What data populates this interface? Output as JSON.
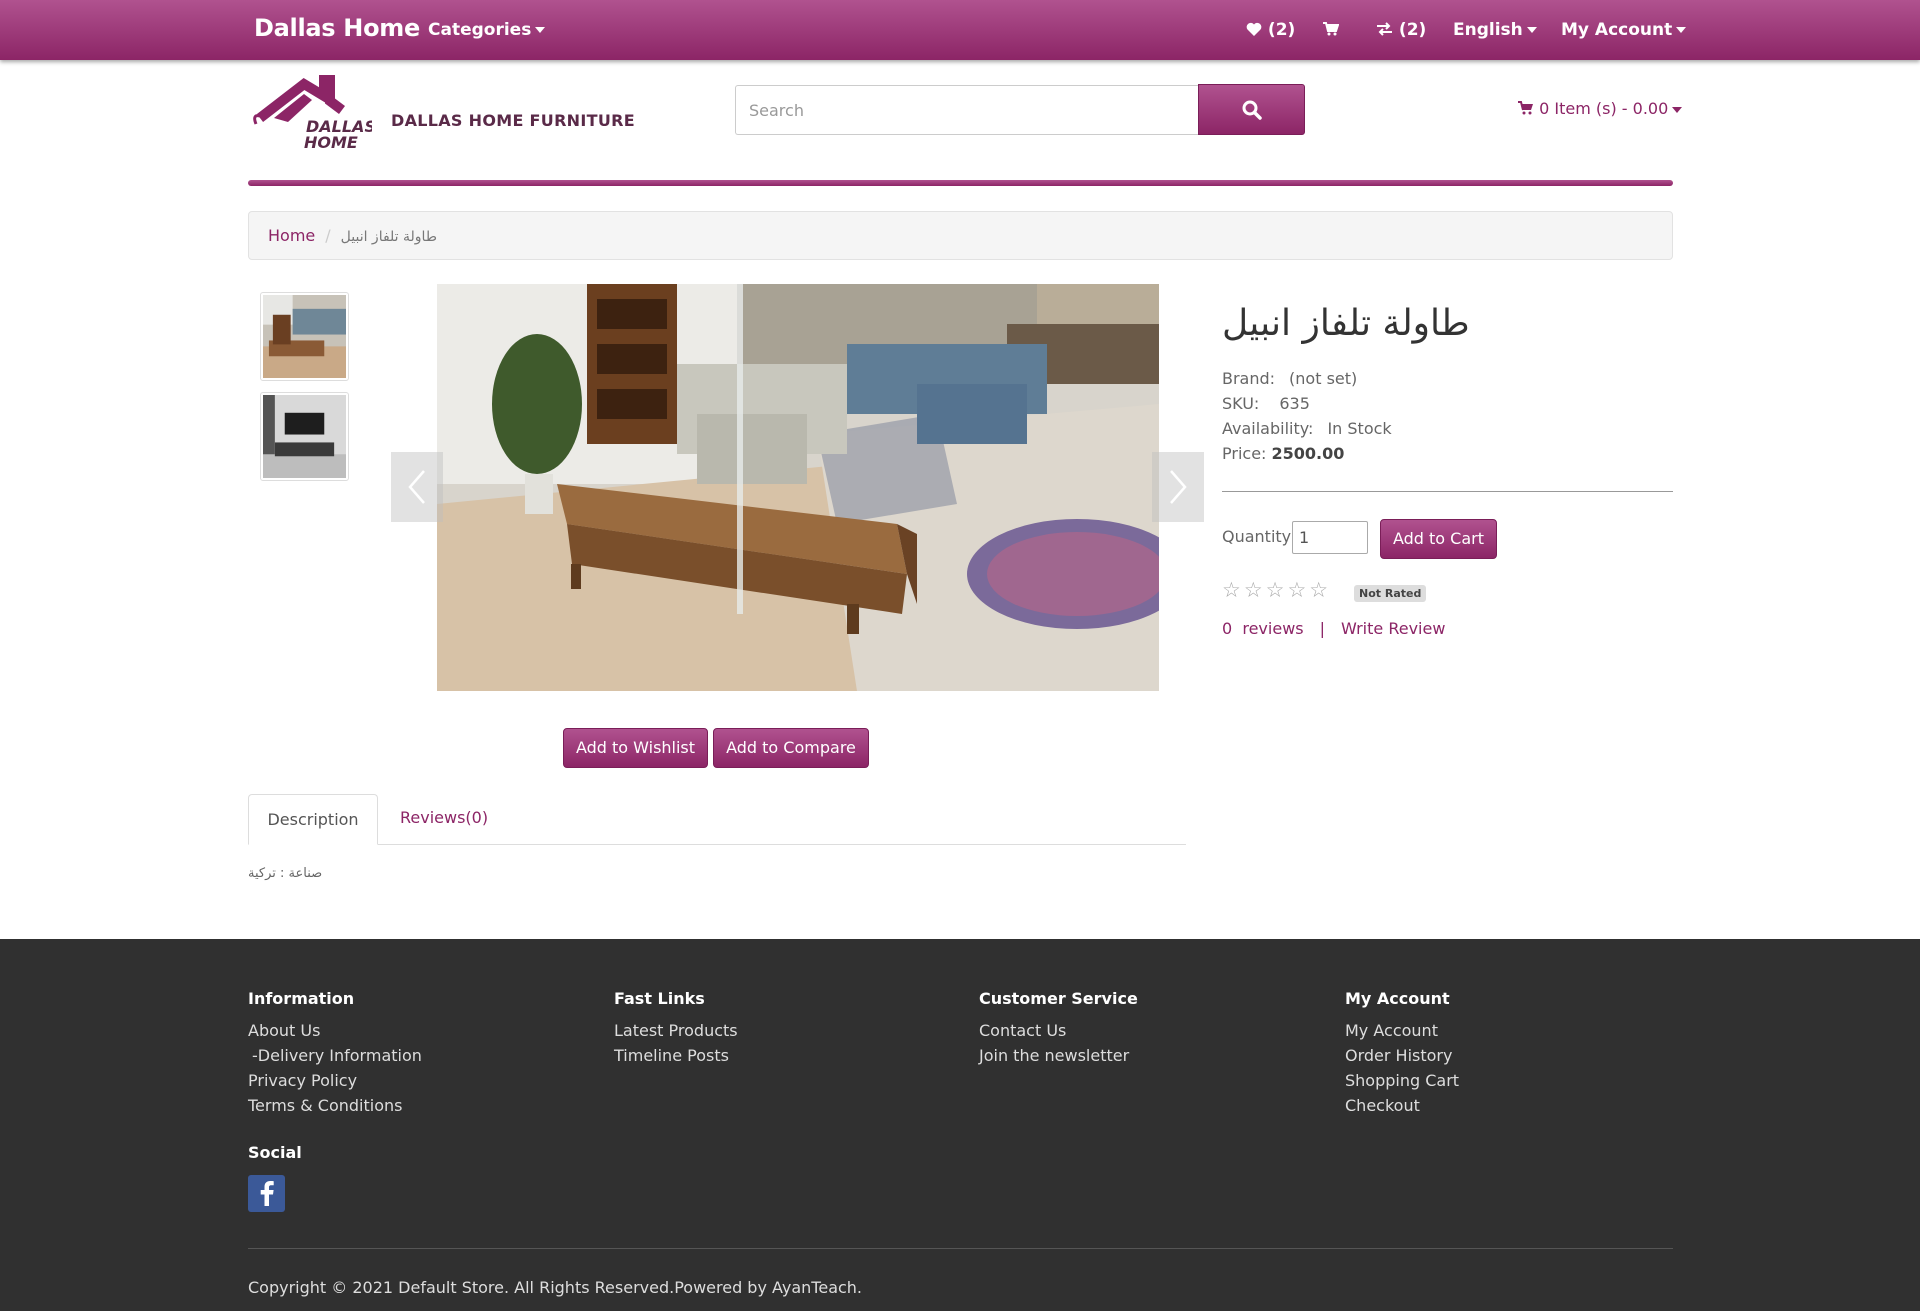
{
  "topbar": {
    "brand": "Dallas Home",
    "categories": "Categories",
    "wishlist_count": "(2)",
    "compare_count": "(2)",
    "language": "English",
    "account": "My Account"
  },
  "header": {
    "logo_text_top": "DALLAS",
    "logo_text_bottom": "HOME",
    "store_name": "DALLAS HOME FURNITURE",
    "search_placeholder": "Search",
    "cart_summary": "0 Item (s) - 0.00"
  },
  "breadcrumb": {
    "home": "Home",
    "separator": "/",
    "current": "طاولة تلفاز انبيل"
  },
  "product": {
    "title": "طاولة تلفاز انبيل",
    "brand_label": "Brand:",
    "brand_value": "(not set)",
    "sku_label": "SKU:",
    "sku_value": "635",
    "availability_label": "Availability:",
    "availability_value": "In Stock",
    "price_label": "Price:",
    "price_value": "2500.00",
    "quantity_label": "Quantity",
    "quantity_value": "1",
    "add_to_cart": "Add to Cart",
    "stars": "☆☆☆☆☆",
    "rating_badge": "Not Rated",
    "reviews_count": "0",
    "reviews_label": "reviews",
    "review_separator": "|",
    "write_review": "Write Review",
    "rating_value": 0,
    "rating_max": 5
  },
  "gallery": {
    "thumb_count": 2,
    "add_to_wishlist": "Add to Wishlist",
    "add_to_compare": "Add to Compare"
  },
  "tabs": {
    "description": "Description",
    "reviews": "Reviews(0)",
    "description_text": "صناعة : تركية"
  },
  "footer": {
    "information": {
      "heading": "Information",
      "links": [
        "About Us",
        "-Delivery Information",
        "Privacy Policy",
        "Terms & Conditions"
      ]
    },
    "fast_links": {
      "heading": "Fast Links",
      "links": [
        "Latest Products",
        "Timeline Posts"
      ]
    },
    "customer_service": {
      "heading": "Customer Service",
      "links": [
        "Contact Us",
        "Join the newsletter"
      ]
    },
    "my_account": {
      "heading": "My Account",
      "links": [
        "My Account",
        "Order History",
        "Shopping Cart",
        "Checkout"
      ]
    },
    "social_heading": "Social",
    "copyright": "Copyright © 2021 Default Store. All Rights Reserved.Powered by AyanTeach."
  },
  "colors": {
    "brand_purple": "#8c2566",
    "brand_purple_light": "#b0528f",
    "footer_bg": "#303030"
  },
  "icons": [
    "heart-icon",
    "cart-icon",
    "compare-icon",
    "search-icon",
    "facebook-icon",
    "chevron-left-icon",
    "chevron-right-icon"
  ]
}
